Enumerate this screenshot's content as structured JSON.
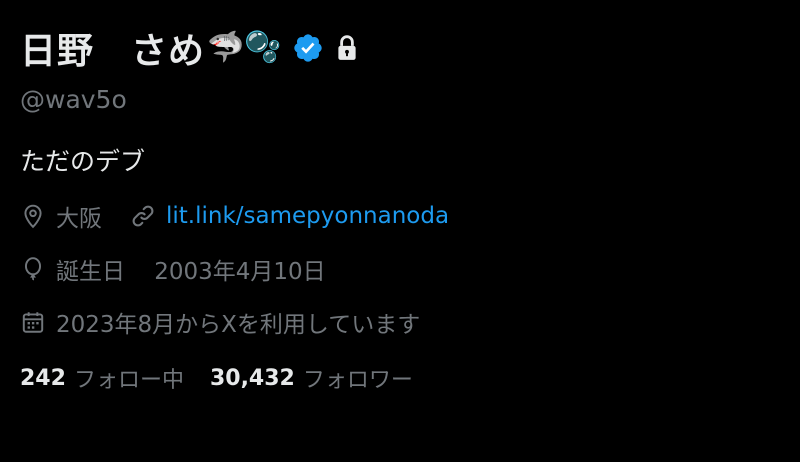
{
  "profile": {
    "display_name": "日野　さめ",
    "name_emojis": "🦈🫧",
    "verified": true,
    "protected": true,
    "handle": "@wav5o",
    "bio": "ただのデブ",
    "location": "大阪",
    "link": "lit.link/samepyonnanoda",
    "birthday_label": "誕生日",
    "birthday": "2003年4月10日",
    "joined": "2023年8月からXを利用しています",
    "following_count": "242",
    "following_label": "フォロー中",
    "followers_count": "30,432",
    "followers_label": "フォロワー"
  },
  "colors": {
    "background": "#000000",
    "text_primary": "#e7e9ea",
    "text_secondary": "#71767b",
    "link": "#1d9bf0",
    "verified_badge": "#1d9bf0"
  },
  "icons": {
    "verified": "verified-badge-icon",
    "lock": "lock-icon",
    "location": "location-pin-icon",
    "link": "link-icon",
    "birthday": "balloon-icon",
    "joined": "calendar-icon"
  }
}
